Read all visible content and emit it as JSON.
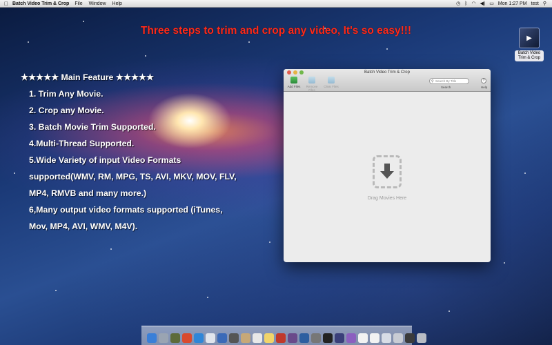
{
  "menubar": {
    "app_name": "Batch Video Trim & Crop",
    "menus": [
      "File",
      "Window",
      "Help"
    ],
    "clock": "Mon 1:27 PM",
    "user": "test"
  },
  "headline": "Three steps to trim and crop any video, It's so easy!!!",
  "features": {
    "heading": "★★★★★ Main Feature ★★★★★",
    "lines": [
      "1. Trim Any Movie.",
      "2. Crop any Movie.",
      "3. Batch Movie Trim Supported.",
      "4.Multi-Thread Supported.",
      "5.Wide Variety of input Video Formats",
      "supported(WMV, RM, MPG, TS, AVI, MKV, MOV, FLV,",
      "MP4, RMVB and many more.)",
      "6,Many output video formats supported (iTunes,",
      "Mov, MP4, AVI, WMV, M4V)."
    ]
  },
  "desktop_icon": {
    "label": "Batch Video Trim & Crop"
  },
  "window": {
    "title": "Batch Video Trim & Crop",
    "toolbar": {
      "add_label": "Add Files",
      "remove_label": "Remove Files",
      "clear_label": "Clear Files",
      "search_placeholder": "Search By Title",
      "search_label": "Search",
      "help_label": "Help"
    },
    "drop_label": "Drag Movies Here"
  },
  "colors": {
    "headline": "#ff2a1a",
    "feature_text": "#ffffff"
  }
}
